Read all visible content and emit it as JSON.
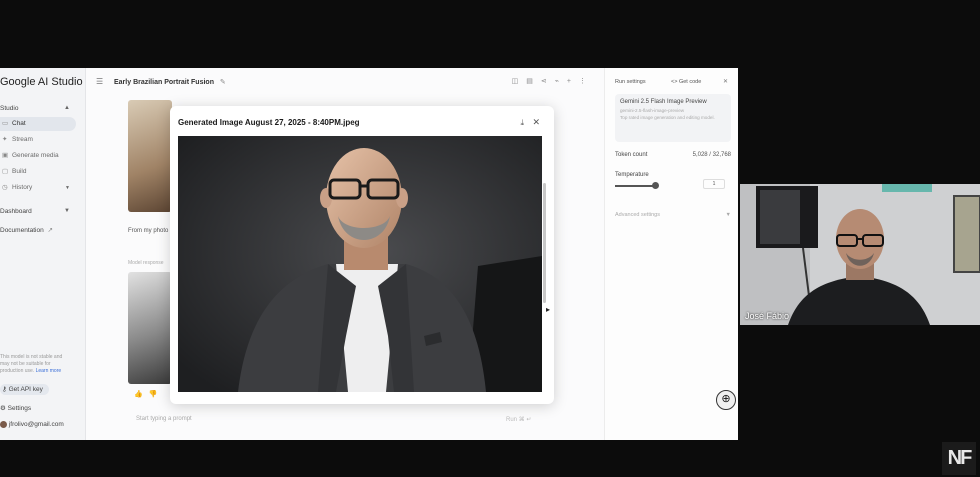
{
  "app": {
    "logo_text": "Google AI Studio",
    "prompt_title": "Early Brazilian Portrait Fusion"
  },
  "sidebar": {
    "studio_label": "Studio",
    "items": [
      {
        "icon": "chat-icon",
        "label": "Chat",
        "active": true
      },
      {
        "icon": "stream-icon",
        "label": "Stream",
        "active": false
      },
      {
        "icon": "media-icon",
        "label": "Generate media",
        "active": false
      },
      {
        "icon": "build-icon",
        "label": "Build",
        "active": false
      },
      {
        "icon": "history-icon",
        "label": "History",
        "active": false
      }
    ],
    "dashboard_label": "Dashboard",
    "documentation_label": "Documentation",
    "note_text": "This model is not stable and may not be suitable for production use.",
    "note_link": "Learn more",
    "api_key_label": "Get API key",
    "settings_label": "Settings",
    "account_email": "jfrolivo@gmail.com"
  },
  "main": {
    "from_text": "From my photo",
    "model_response_label": "Model response",
    "prompt_placeholder": "Start typing a prompt",
    "run_label": "Run"
  },
  "run_settings": {
    "header": "Run settings",
    "get_code": "Get code",
    "model_name": "Gemini 2.5 Flash Image Preview",
    "model_id": "gemini-2.5-flash-image-preview",
    "model_desc": "Top rated image generation and editing model.",
    "token_label": "Token count",
    "token_value": "5,028 / 32,768",
    "temperature_label": "Temperature",
    "temperature_value": "1",
    "temperature_level": 0.5,
    "advanced_label": "Advanced settings"
  },
  "modal": {
    "title": "Generated Image August 27, 2025 - 8:40PM.jpeg"
  },
  "webcam": {
    "name": "José Fábio"
  },
  "overlay": {
    "logo": "NF"
  }
}
